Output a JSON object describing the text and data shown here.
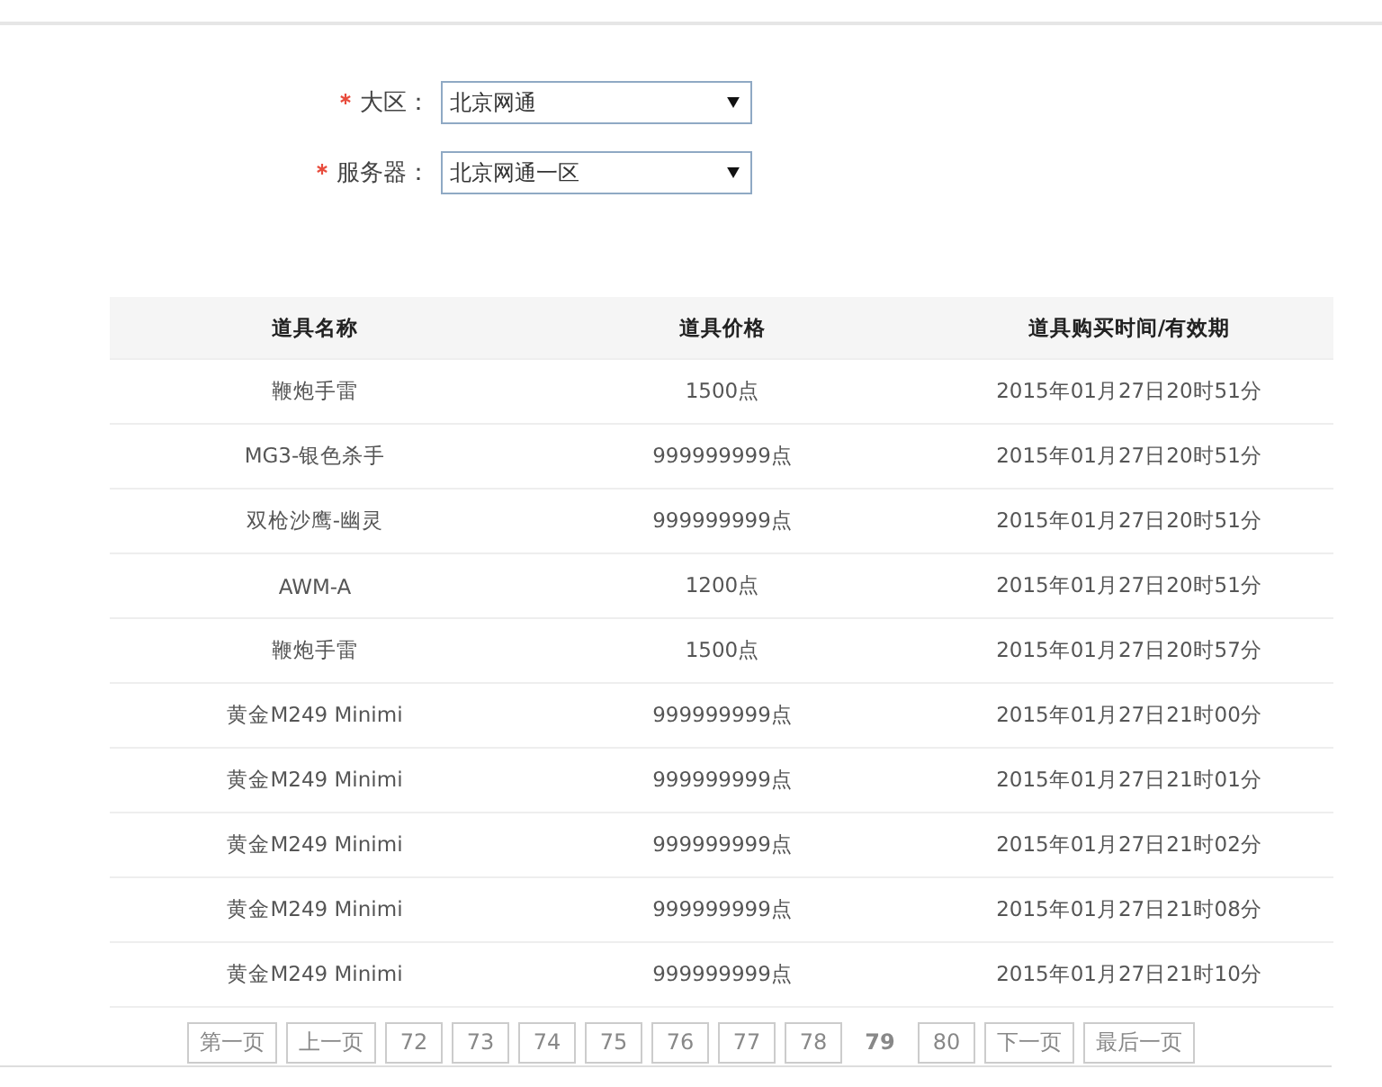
{
  "form": [
    {
      "label": "大区：",
      "required": true,
      "value": "北京网通"
    },
    {
      "label": "服务器：",
      "required": true,
      "value": "北京网通一区"
    }
  ],
  "table": {
    "columns": [
      "道具名称",
      "道具价格",
      "道具购买时间/有效期"
    ],
    "rows": [
      [
        "鞭炮手雷",
        "1500点",
        "2015年01月27日20时51分"
      ],
      [
        "MG3-银色杀手",
        "999999999点",
        "2015年01月27日20时51分"
      ],
      [
        "双枪沙鹰-幽灵",
        "999999999点",
        "2015年01月27日20时51分"
      ],
      [
        "AWM-A",
        "1200点",
        "2015年01月27日20时51分"
      ],
      [
        "鞭炮手雷",
        "1500点",
        "2015年01月27日20时57分"
      ],
      [
        "黄金M249 Minimi",
        "999999999点",
        "2015年01月27日21时00分"
      ],
      [
        "黄金M249 Minimi",
        "999999999点",
        "2015年01月27日21时01分"
      ],
      [
        "黄金M249 Minimi",
        "999999999点",
        "2015年01月27日21时02分"
      ],
      [
        "黄金M249 Minimi",
        "999999999点",
        "2015年01月27日21时08分"
      ],
      [
        "黄金M249 Minimi",
        "999999999点",
        "2015年01月27日21时10分"
      ]
    ]
  },
  "pagination": [
    {
      "label": "第一页",
      "selected": false
    },
    {
      "label": "上一页",
      "selected": false
    },
    {
      "label": "72",
      "selected": false
    },
    {
      "label": "73",
      "selected": false
    },
    {
      "label": "74",
      "selected": false
    },
    {
      "label": "75",
      "selected": false
    },
    {
      "label": "76",
      "selected": false
    },
    {
      "label": "77",
      "selected": false
    },
    {
      "label": "78",
      "selected": false
    },
    {
      "label": "79",
      "selected": true
    },
    {
      "label": "80",
      "selected": false
    },
    {
      "label": "下一页",
      "selected": false
    },
    {
      "label": "最后一页",
      "selected": false
    }
  ]
}
